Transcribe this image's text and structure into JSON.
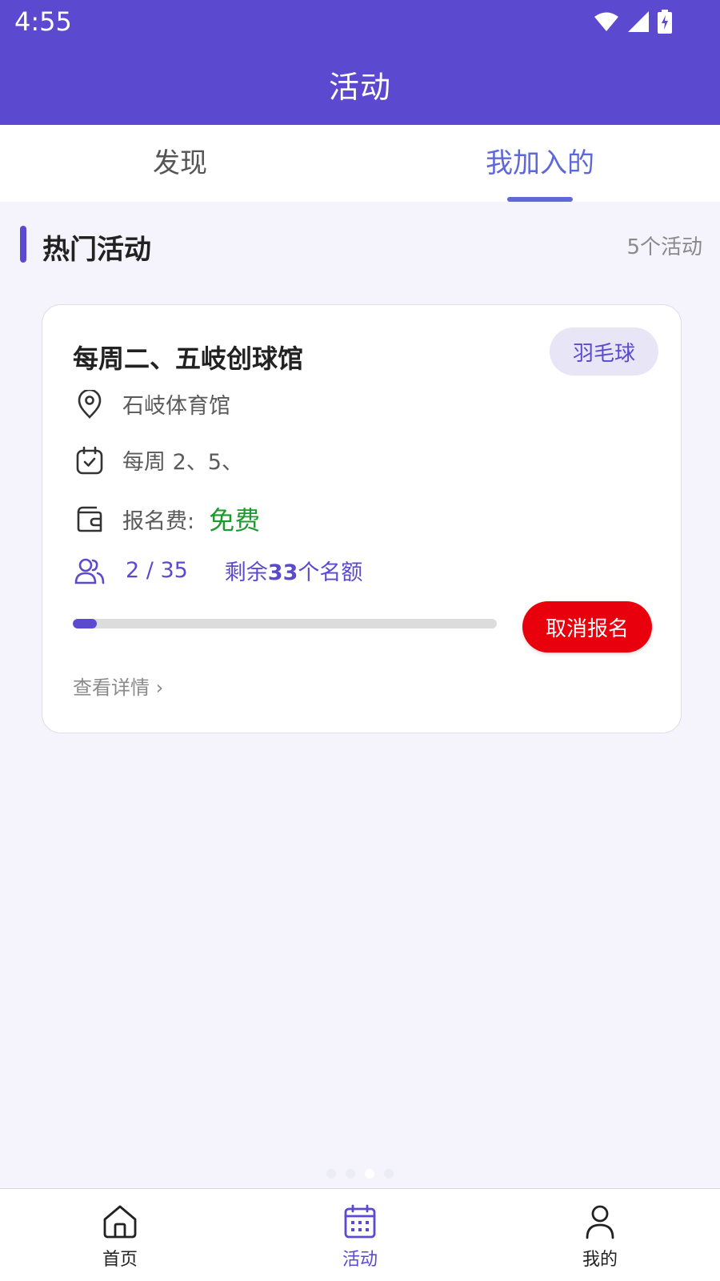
{
  "status_bar": {
    "time": "4:55",
    "icons": [
      "wifi-icon",
      "signal-icon",
      "battery-charging-icon"
    ]
  },
  "header": {
    "title": "活动"
  },
  "tabs": [
    {
      "label": "发现",
      "active": false
    },
    {
      "label": "我加入的",
      "active": true
    }
  ],
  "section": {
    "title": "热门活动",
    "count": "5个活动"
  },
  "card": {
    "title": "每周二、五岐创球馆",
    "tag": "羽毛球",
    "location": "石岐体育馆",
    "schedule": "每周 2、5、",
    "fee_label": "报名费:",
    "fee_value": "免费",
    "people_count": "2 / 35",
    "remaining_prefix": "剩余",
    "remaining_number": "33",
    "remaining_suffix": "个名额",
    "progress_fraction": 0.057,
    "cancel_label": "取消报名",
    "detail_label": "查看详情 ›"
  },
  "bottom_nav": [
    {
      "label": "首页",
      "icon": "home-icon",
      "active": false
    },
    {
      "label": "活动",
      "icon": "calendar-icon",
      "active": true
    },
    {
      "label": "我的",
      "icon": "user-icon",
      "active": false
    }
  ],
  "colors": {
    "primary": "#5b4acf",
    "tab_active": "#5f68d8",
    "danger": "#e8000d",
    "free_green": "#1d9a2c",
    "background": "#f5f4fc"
  }
}
